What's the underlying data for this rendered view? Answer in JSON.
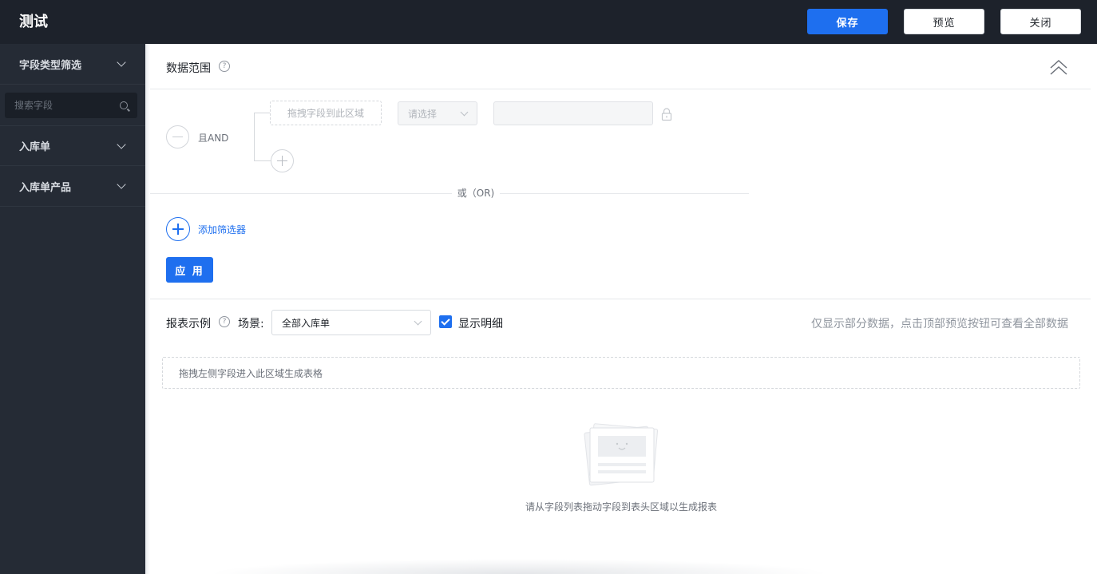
{
  "header": {
    "title": "测试",
    "save_label": "保存",
    "preview_label": "预览",
    "close_label": "关闭"
  },
  "sidebar": {
    "filter_label": "字段类型筛选",
    "search_placeholder": "搜索字段",
    "groups": [
      {
        "label": "入库单"
      },
      {
        "label": "入库单产品"
      }
    ]
  },
  "data_range": {
    "title": "数据范围",
    "and_label": "且AND",
    "drop_field_placeholder": "拖拽字段到此区域",
    "operator_placeholder": "请选择",
    "or_label": "或（OR)",
    "add_filter_label": "添加筛选器",
    "apply_label": "应 用"
  },
  "report": {
    "title": "报表示例",
    "scene_label": "场景:",
    "scene_value": "全部入库单",
    "show_detail_label": "显示明细",
    "show_detail_checked": true,
    "hint": "仅显示部分数据，点击顶部预览按钮可查看全部数据",
    "drop_table_hint": "拖拽左侧字段进入此区域生成表格",
    "empty_text": "请从字段列表拖动字段到表头区域以生成报表"
  },
  "colors": {
    "accent": "#1e6fef",
    "topbar": "#1d222b",
    "sidebar": "#252b35"
  }
}
